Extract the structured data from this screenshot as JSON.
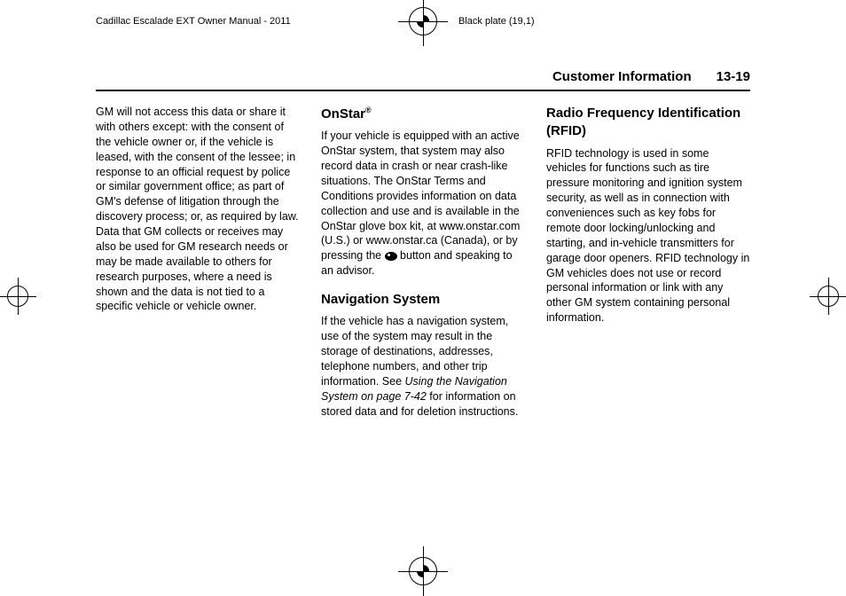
{
  "topHeader": {
    "left": "Cadillac Escalade EXT Owner Manual - 2011",
    "right": "Black plate (19,1)"
  },
  "pageHeader": {
    "title": "Customer Information",
    "pageNumber": "13-19"
  },
  "column1": {
    "body": "GM will not access this data or share it with others except: with the consent of the vehicle owner or, if the vehicle is leased, with the consent of the lessee; in response to an official request by police or similar government office; as part of GM's defense of litigation through the discovery process; or, as required by law. Data that GM collects or receives may also be used for GM research needs or may be made available to others for research purposes, where a need is shown and the data is not tied to a specific vehicle or vehicle owner."
  },
  "column2": {
    "onstarHeading": "OnStar",
    "onstarSup": "®",
    "onstarBody1": "If your vehicle is equipped with an active OnStar system, that system may also record data in crash or near crash-like situations. The OnStar Terms and Conditions provides information on data collection and use and is available in the OnStar glove box kit, at www.onstar.com (U.S.) or www.onstar.ca (Canada), or by pressing the ",
    "onstarBody2": " button and speaking to an advisor.",
    "navHeading": "Navigation System",
    "navBody1": "If the vehicle has a navigation system, use of the system may result in the storage of destinations, addresses, telephone numbers, and other trip information. See ",
    "navItalic": "Using the Navigation System on page 7‑42",
    "navBody2": " for information on stored data and for deletion instructions."
  },
  "column3": {
    "rfidHeading": "Radio Frequency Identification (RFID)",
    "rfidBody": "RFID technology is used in some vehicles for functions such as tire pressure monitoring and ignition system security, as well as in connection with conveniences such as key fobs for remote door locking/unlocking and starting, and in-vehicle transmitters for garage door openers. RFID technology in GM vehicles does not use or record personal information or link with any other GM system containing personal information."
  }
}
